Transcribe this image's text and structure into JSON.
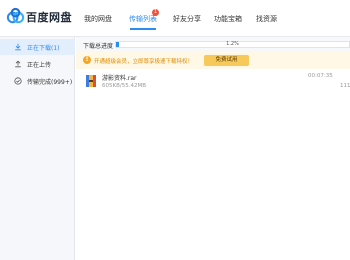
{
  "header": {
    "brand": "百度网盘",
    "nav": [
      {
        "label": "我的网盘"
      },
      {
        "label": "传输列表",
        "badge": "1"
      },
      {
        "label": "好友分享"
      },
      {
        "label": "功能宝箱"
      },
      {
        "label": "找资源"
      }
    ]
  },
  "sidebar": {
    "items": [
      {
        "label": "正在下载(1)",
        "icon": "download-icon",
        "active": true
      },
      {
        "label": "正在上传",
        "icon": "upload-icon",
        "active": false
      },
      {
        "label": "传输完成(999+)",
        "icon": "check-circle-icon",
        "active": false
      }
    ]
  },
  "main": {
    "download_progress": {
      "label": "下载总进度",
      "percent_text": "1.2%",
      "value": 0.012
    },
    "notice": {
      "text": "开通超级会员，立即尊享极速下载特权！",
      "button": "免费试用"
    },
    "tasks": [
      {
        "name": "游影资料.rar",
        "size": "605KB/55.42MB",
        "time": "00:07:35",
        "extra": "111",
        "icon": "archive-file-icon"
      }
    ]
  },
  "colors": {
    "accent": "#2d8cf0",
    "notice_bg": "#fff8e6",
    "notice_text": "#e08a00",
    "badge": "#f0523c"
  }
}
